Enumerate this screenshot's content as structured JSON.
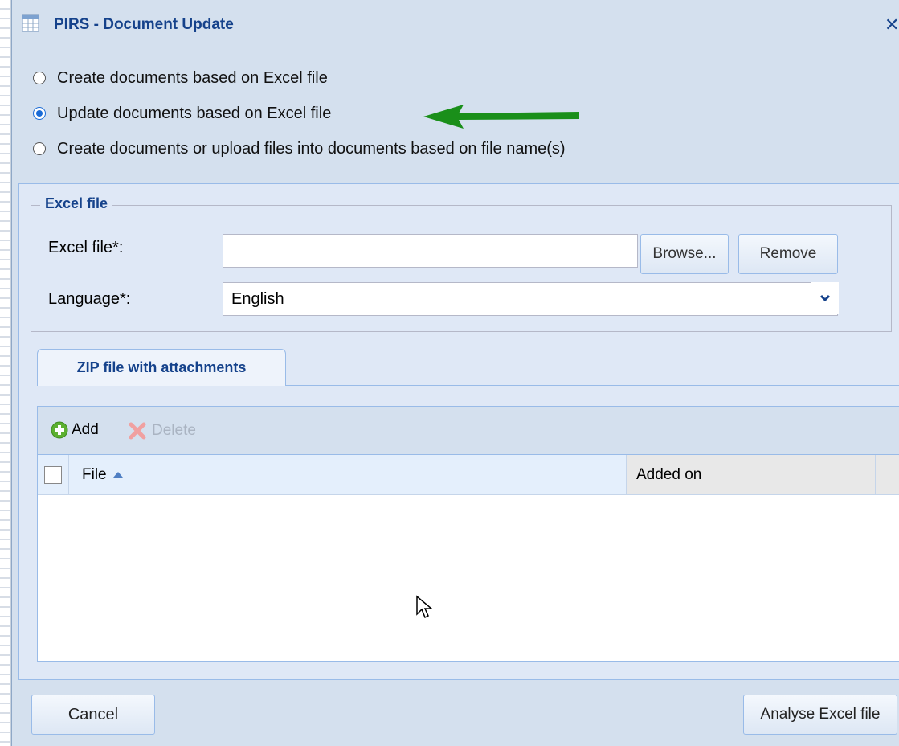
{
  "window": {
    "title": "PIRS - Document Update",
    "title_icon": "table-icon",
    "close_icon": "close-icon",
    "accent_color": "#15428b"
  },
  "mode_options": [
    {
      "label": "Create documents based on Excel file",
      "checked": false
    },
    {
      "label": "Update documents based on Excel file",
      "checked": true
    },
    {
      "label": "Create documents or upload files into documents based on file name(s)",
      "checked": false
    }
  ],
  "annotation": {
    "icon": "green-arrow-icon",
    "color": "#1a8f1a"
  },
  "excel_section": {
    "legend": "Excel file",
    "excel_file_label": "Excel file*:",
    "excel_file_value": "",
    "browse_label": "Browse...",
    "remove_label": "Remove",
    "language_label": "Language*:",
    "language_value": "English"
  },
  "tabs": [
    {
      "label": "ZIP file with attachments",
      "active": true
    }
  ],
  "grid": {
    "toolbar": {
      "add_label": "Add",
      "delete_label": "Delete"
    },
    "columns": [
      "File",
      "Added on"
    ],
    "sort": {
      "column": "File",
      "direction": "ascending"
    },
    "rows": []
  },
  "footer": {
    "cancel_label": "Cancel",
    "analyse_label": "Analyse Excel file"
  }
}
